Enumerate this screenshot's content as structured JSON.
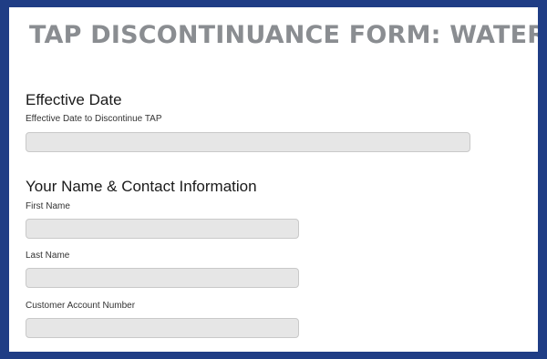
{
  "form": {
    "title": "TAP DISCONTINUANCE FORM: WATER BILL"
  },
  "sections": {
    "effective_date": {
      "heading": "Effective Date",
      "field_label": "Effective Date to Discontinue TAP",
      "value": ""
    },
    "contact": {
      "heading": "Your Name & Contact Information",
      "first_name_label": "First Name",
      "first_name_value": "",
      "last_name_label": "Last Name",
      "last_name_value": "",
      "account_number_label": "Customer Account Number",
      "account_number_value": ""
    }
  },
  "colors": {
    "frame_border": "#1f3d85",
    "title_gray": "#8a8d91",
    "input_fill": "#e6e6e6"
  }
}
